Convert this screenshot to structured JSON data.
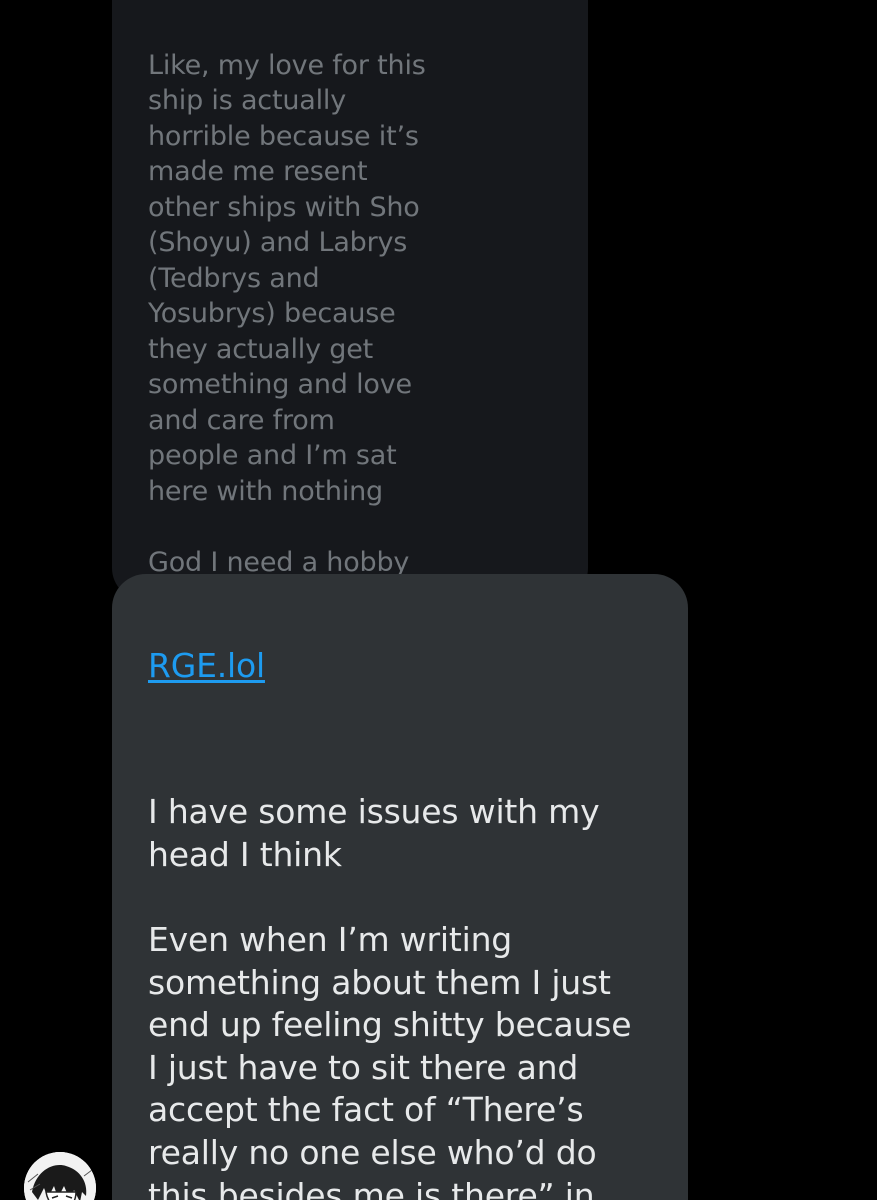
{
  "messages": [
    {
      "sender": "other",
      "text": "Like, my love for this\nship is actually\nhorrible because it’s\nmade me resent\nother ships with Sho\n(Shoyu) and Labrys\n(Tedbrys and\nYosubrys) because\nthey actually get\nsomething and love\nand care from\npeople and I’m sat\nhere with nothing\n\nGod I need a hobby"
    },
    {
      "sender": "other",
      "link": "RGE.lol",
      "text": "I have some issues with my\nhead I think\n\nEven when I’m writing\nsomething about them I just\nend up feeling shitty because\nI just have to sit there and\naccept the fact of “There’s\nreally no one else who’d do\nthis besides me is there” in\nthe middle of it"
    }
  ],
  "avatar": {
    "icon": "manga-character-avatar-icon"
  },
  "colors": {
    "background": "#000000",
    "faded_bubble": "#16181c",
    "bubble": "#2f3336",
    "link": "#1d9bf0",
    "text": "#e7e9ea",
    "faded_text": "#71767b"
  }
}
